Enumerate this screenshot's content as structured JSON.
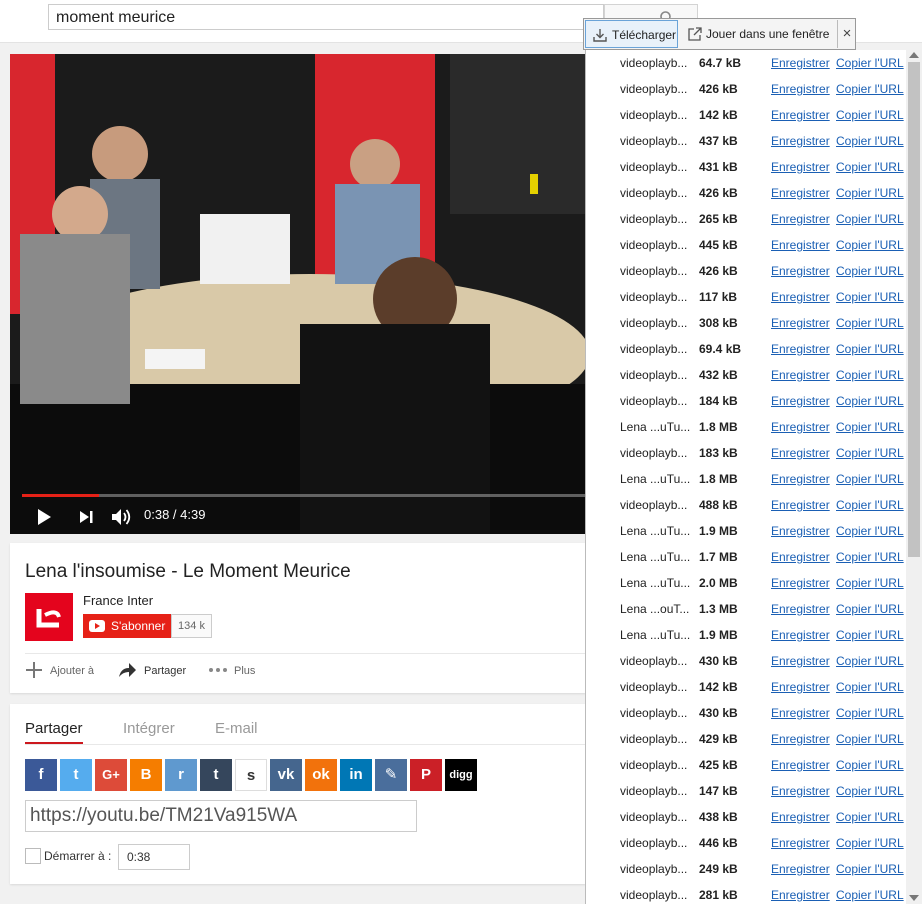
{
  "search": {
    "value": "moment meurice"
  },
  "player": {
    "time": "0:38 / 4:39",
    "progress": 0.136
  },
  "video_info": {
    "title": "Lena l'insoumise - Le Moment Meurice",
    "channel": "France Inter",
    "subscribe_label": "S'abonner",
    "subscriber_count": "134 k",
    "actions": {
      "add_label": "Ajouter à",
      "share_label": "Partager",
      "more_label": "Plus"
    }
  },
  "share": {
    "tabs": [
      "Partager",
      "Intégrer",
      "E-mail"
    ],
    "active_tab": "Partager",
    "url": "https://youtu.be/TM21Va915WA",
    "start_label": "Démarrer à :",
    "start_time": "0:38",
    "services": [
      {
        "name": "facebook",
        "glyph": "f",
        "color": "#3b5998"
      },
      {
        "name": "twitter",
        "glyph": "t",
        "color": "#55acee"
      },
      {
        "name": "google-plus",
        "glyph": "G+",
        "color": "#dd4b39"
      },
      {
        "name": "blogger",
        "glyph": "B",
        "color": "#f57d00"
      },
      {
        "name": "reddit",
        "glyph": "r",
        "color": "#5f99cf"
      },
      {
        "name": "tumblr",
        "glyph": "t",
        "color": "#35465c"
      },
      {
        "name": "stumbleupon",
        "glyph": "s",
        "color": "#ffffff"
      },
      {
        "name": "vk",
        "glyph": "vk",
        "color": "#45668e"
      },
      {
        "name": "odnoklassniki",
        "glyph": "ok",
        "color": "#f2720c"
      },
      {
        "name": "linkedin",
        "glyph": "in",
        "color": "#0077b5"
      },
      {
        "name": "livejournal",
        "glyph": "✎",
        "color": "#4a6e9c"
      },
      {
        "name": "pinterest",
        "glyph": "P",
        "color": "#cb2027"
      },
      {
        "name": "digg",
        "glyph": "digg",
        "color": "#000000"
      }
    ]
  },
  "extension": {
    "download_label": "Télécharger",
    "window_label": "Jouer dans une fenêtre",
    "close_label": "×",
    "save_label": "Enregistrer",
    "copy_label": "Copier l'URL",
    "rows": [
      {
        "name": "videoplayb...",
        "size": "64.7 kB"
      },
      {
        "name": "videoplayb...",
        "size": "426 kB"
      },
      {
        "name": "videoplayb...",
        "size": "142 kB"
      },
      {
        "name": "videoplayb...",
        "size": "437 kB"
      },
      {
        "name": "videoplayb...",
        "size": "431 kB"
      },
      {
        "name": "videoplayb...",
        "size": "426 kB"
      },
      {
        "name": "videoplayb...",
        "size": "265 kB"
      },
      {
        "name": "videoplayb...",
        "size": "445 kB"
      },
      {
        "name": "videoplayb...",
        "size": "426 kB"
      },
      {
        "name": "videoplayb...",
        "size": "117 kB"
      },
      {
        "name": "videoplayb...",
        "size": "308 kB"
      },
      {
        "name": "videoplayb...",
        "size": "69.4 kB"
      },
      {
        "name": "videoplayb...",
        "size": "432 kB"
      },
      {
        "name": "videoplayb...",
        "size": "184 kB"
      },
      {
        "name": "Lena ...uTu...",
        "size": "1.8 MB"
      },
      {
        "name": "videoplayb...",
        "size": "183 kB"
      },
      {
        "name": "Lena ...uTu...",
        "size": "1.8 MB"
      },
      {
        "name": "videoplayb...",
        "size": "488 kB"
      },
      {
        "name": "Lena ...uTu...",
        "size": "1.9 MB"
      },
      {
        "name": "Lena ...uTu...",
        "size": "1.7 MB"
      },
      {
        "name": "Lena ...uTu...",
        "size": "2.0 MB"
      },
      {
        "name": "Lena ...ouT...",
        "size": "1.3 MB"
      },
      {
        "name": "Lena ...uTu...",
        "size": "1.9 MB"
      },
      {
        "name": "videoplayb...",
        "size": "430 kB"
      },
      {
        "name": "videoplayb...",
        "size": "142 kB"
      },
      {
        "name": "videoplayb...",
        "size": "430 kB"
      },
      {
        "name": "videoplayb...",
        "size": "429 kB"
      },
      {
        "name": "videoplayb...",
        "size": "425 kB"
      },
      {
        "name": "videoplayb...",
        "size": "147 kB"
      },
      {
        "name": "videoplayb...",
        "size": "438 kB"
      },
      {
        "name": "videoplayb...",
        "size": "446 kB"
      },
      {
        "name": "videoplayb...",
        "size": "249 kB"
      },
      {
        "name": "videoplayb...",
        "size": "281 kB"
      }
    ]
  }
}
